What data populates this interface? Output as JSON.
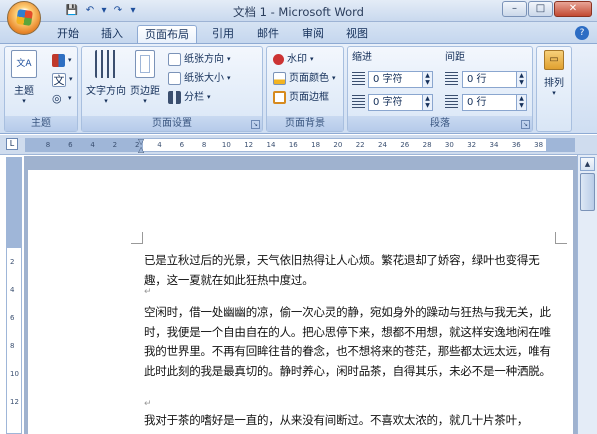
{
  "window": {
    "title": "文档 1 - Microsoft Word",
    "controls": {
      "minimize": "–",
      "maximize": "□",
      "close": "✕"
    }
  },
  "qat": {
    "save": "💾",
    "undo": "↶",
    "undo_drop": "▾",
    "redo": "↷",
    "customize": "▾"
  },
  "tabs": [
    "开始",
    "插入",
    "页面布局",
    "引用",
    "邮件",
    "审阅",
    "视图"
  ],
  "active_tab": "页面布局",
  "help": "?",
  "ribbon": {
    "themes": {
      "label": "主题",
      "theme_button": "主题",
      "theme_text_icon": "文A",
      "font_icon": "文",
      "colors_icon": "■",
      "effects_icon": "◎"
    },
    "page_setup": {
      "label": "页面设置",
      "text_direction": "文字方向",
      "margins": "页边距",
      "orientation": "纸张方向",
      "size": "纸张大小",
      "columns": "分栏"
    },
    "page_background": {
      "label": "页面背景",
      "watermark": "水印",
      "page_color": "页面颜色",
      "page_borders": "页面边框"
    },
    "paragraph": {
      "label": "段落",
      "indent_label": "缩进",
      "spacing_label": "间距",
      "indent_left": "0 字符",
      "indent_right": "0 字符",
      "spacing_before": "0 行",
      "spacing_after": "0 行"
    },
    "arrange": {
      "label": "排列",
      "icon_text": "▭"
    }
  },
  "ruler": {
    "corner": "L",
    "ticks": [
      "8",
      "6",
      "4",
      "2",
      "2",
      "4",
      "6",
      "8",
      "10",
      "12",
      "14",
      "16",
      "18",
      "20",
      "22",
      "24",
      "26",
      "28",
      "30",
      "32",
      "34",
      "36",
      "38"
    ],
    "vticks": [
      "2",
      "4",
      "6",
      "8",
      "10",
      "12"
    ]
  },
  "scroll": {
    "up": "▲"
  },
  "document": {
    "pilcrow": "↵",
    "paragraphs": [
      "已是立秋过后的光景，天气依旧热得让人心烦。繁花退却了娇容，绿叶也变得无趣，这一夏就在如此狂热中度过。",
      "空闲时，借一处幽幽的凉，偷一次心灵的静，宛如身外的躁动与狂热与我无关，此时，我便是一个自由自在的人。把心思停下来，想都不用想，就这样安逸地闲在唯我的世界里。不再有回眸往昔的眷念，也不想将来的苍茫，那些都太远太远，唯有此时此刻的我是最真切的。静时养心，闲时品茶，自得其乐，未必不是一种洒脱。",
      "我对于茶的嗜好是一直的，从来没有间断过。不喜欢太浓的，就几十片茶叶，"
    ]
  }
}
